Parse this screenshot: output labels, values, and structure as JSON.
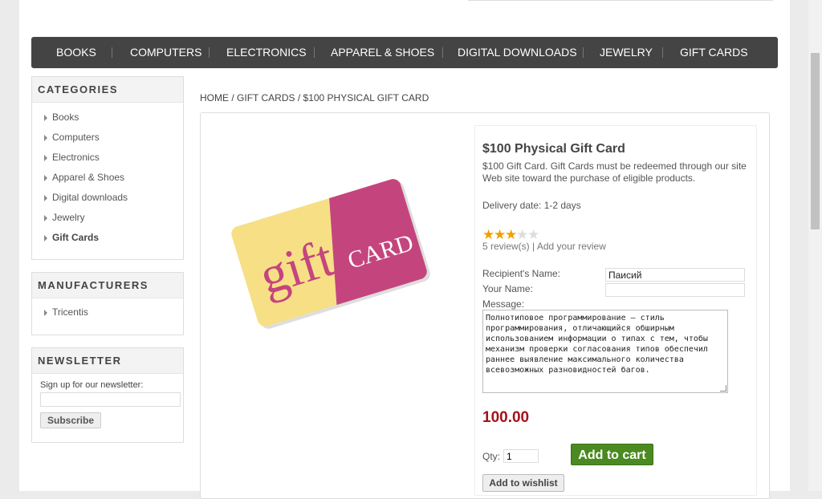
{
  "nav": [
    "BOOKS",
    "COMPUTERS",
    "ELECTRONICS",
    "APPAREL & SHOES",
    "DIGITAL DOWNLOADS",
    "JEWELRY",
    "GIFT CARDS"
  ],
  "categories": {
    "title": "CATEGORIES",
    "items": [
      "Books",
      "Computers",
      "Electronics",
      "Apparel & Shoes",
      "Digital downloads",
      "Jewelry",
      "Gift Cards"
    ],
    "active": "Gift Cards"
  },
  "manufacturers": {
    "title": "MANUFACTURERS",
    "items": [
      "Tricentis"
    ]
  },
  "newsletter": {
    "title": "NEWSLETTER",
    "label": "Sign up for our newsletter:",
    "email_value": "",
    "button": "Subscribe"
  },
  "breadcrumb": {
    "home": "HOME",
    "sep": "/",
    "category": "GIFT CARDS",
    "current": "$100 PHYSICAL GIFT CARD"
  },
  "product": {
    "name": "$100 Physical Gift Card",
    "description": "$100 Gift Card. Gift Cards must be redeemed through our site Web site toward the purchase of eligible products.",
    "delivery": "Delivery date: 1-2 days",
    "rating": 3,
    "rating_max": 5,
    "reviews_link": "5 review(s)",
    "reviews_sep": "|",
    "add_review": "Add your review",
    "recipient_label": "Recipient's Name:",
    "recipient_value": "Паисий",
    "your_name_label": "Your Name:",
    "your_name_value": "",
    "message_label": "Message:",
    "message_value": "Полнотиповое программирование — стиль программирования, отличающийся обширным использованием информации о типах с тем, чтобы механизм проверки согласования типов обеспечил раннее выявление максимального количества всевозможных разновидностей багов.",
    "price": "100.00",
    "qty_label": "Qty:",
    "qty_value": "1",
    "add_to_cart": "Add to cart",
    "add_to_wishlist": "Add to wishlist",
    "image_text_gift": "gift",
    "image_text_card": "CARD"
  },
  "colors": {
    "menu_bg": "#444444",
    "price": "#a5121c",
    "cart_button": "#4a8a21",
    "card_yellow": "#f7df86",
    "card_pink": "#c4457e"
  }
}
